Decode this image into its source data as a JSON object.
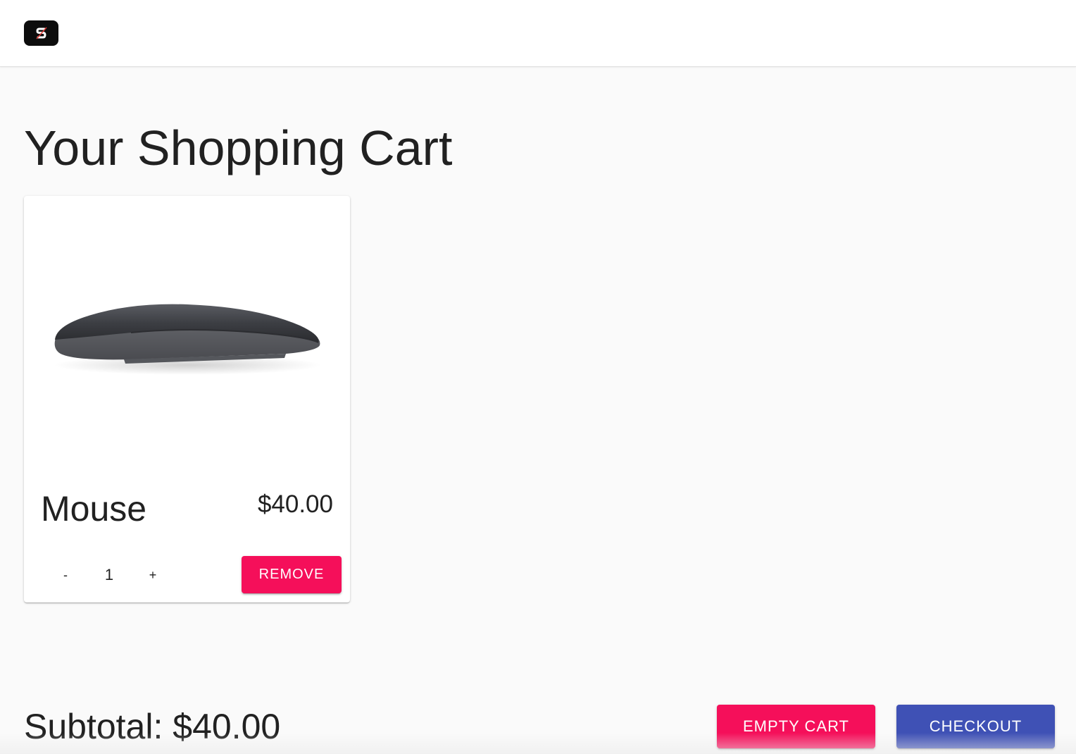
{
  "header": {
    "logo_icon": "commerce-logo-icon",
    "logo_letter": "S"
  },
  "page": {
    "title": "Your Shopping Cart"
  },
  "cart": {
    "items": [
      {
        "name": "Mouse",
        "price": "$40.00",
        "image_icon": "mouse-product-image",
        "decrement_label": "-",
        "quantity": "1",
        "increment_label": "+",
        "remove_label": "REMOVE"
      }
    ],
    "subtotal": "Subtotal: $40.00",
    "empty_cart_label": "EMPTY CART",
    "checkout_label": "CHECKOUT"
  },
  "colors": {
    "accent_pink": "#f50f5a",
    "primary_indigo": "#3f51b5",
    "background": "#fafafa"
  }
}
